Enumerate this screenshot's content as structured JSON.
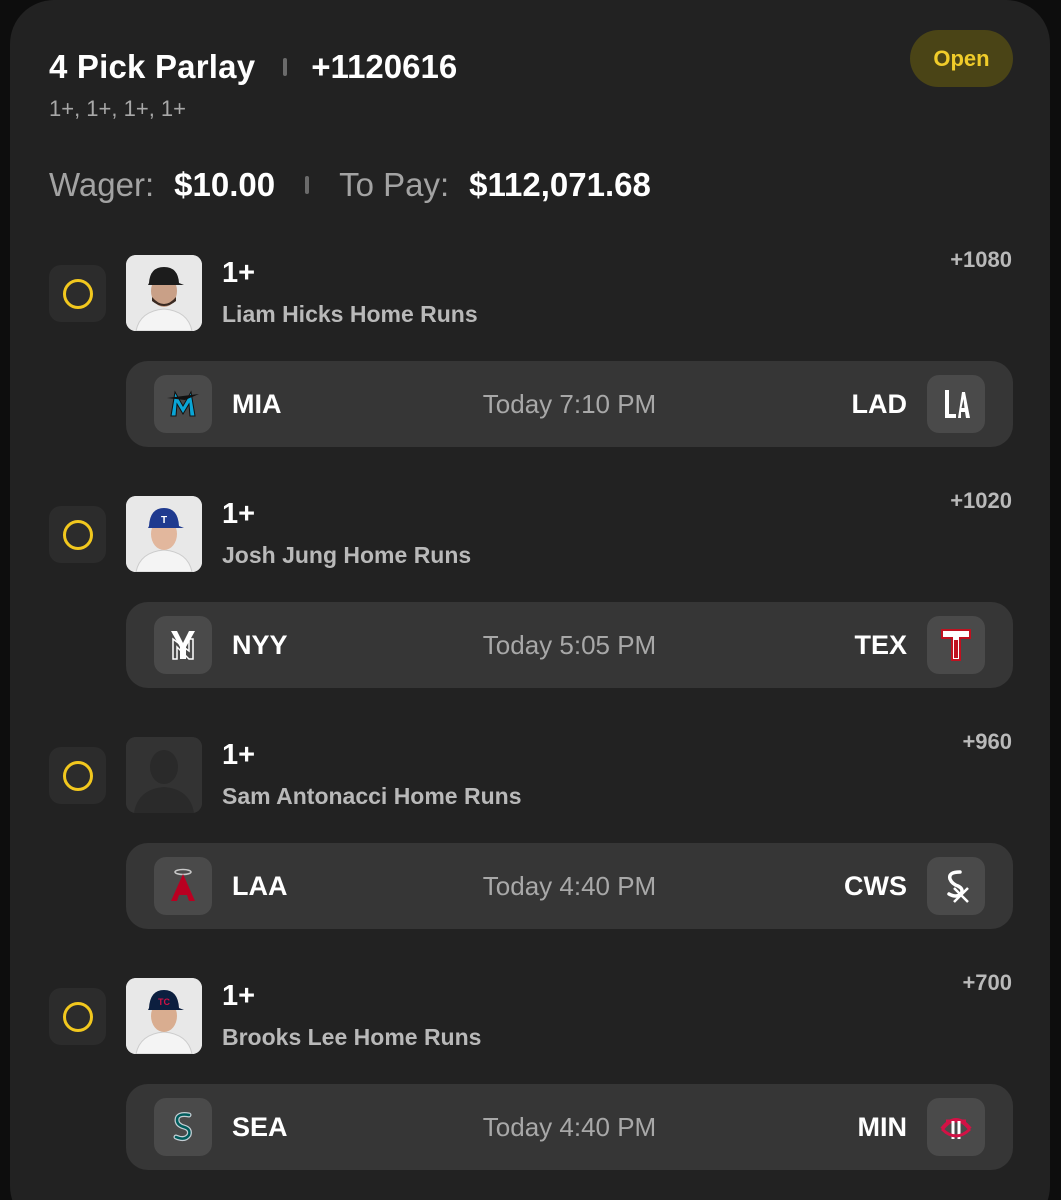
{
  "header": {
    "title": "4 Pick Parlay",
    "total_odds": "+1120616",
    "subtitle": "1+, 1+, 1+, 1+",
    "status": "Open"
  },
  "money": {
    "wager_label": "Wager:",
    "wager_value": "$10.00",
    "payout_label": "To Pay:",
    "payout_value": "$112,071.68"
  },
  "colors": {
    "accent_yellow": "#f2c81e",
    "card_bg": "#222222",
    "game_row_bg": "#363636"
  },
  "legs": [
    {
      "line": "1+",
      "market": "Liam Hicks Home Runs",
      "odds": "+1080",
      "player_image": "player-headshot",
      "away": {
        "abbr": "MIA",
        "icon": "marlins-logo-icon"
      },
      "time": "Today 7:10 PM",
      "home": {
        "abbr": "LAD",
        "icon": "dodgers-logo-icon"
      }
    },
    {
      "line": "1+",
      "market": "Josh Jung Home Runs",
      "odds": "+1020",
      "player_image": "player-headshot",
      "away": {
        "abbr": "NYY",
        "icon": "yankees-logo-icon"
      },
      "time": "Today 5:05 PM",
      "home": {
        "abbr": "TEX",
        "icon": "rangers-logo-icon"
      }
    },
    {
      "line": "1+",
      "market": "Sam Antonacci Home Runs",
      "odds": "+960",
      "player_image": "player-placeholder",
      "away": {
        "abbr": "LAA",
        "icon": "angels-logo-icon"
      },
      "time": "Today 4:40 PM",
      "home": {
        "abbr": "CWS",
        "icon": "white-sox-logo-icon"
      }
    },
    {
      "line": "1+",
      "market": "Brooks Lee Home Runs",
      "odds": "+700",
      "player_image": "player-headshot",
      "away": {
        "abbr": "SEA",
        "icon": "mariners-logo-icon"
      },
      "time": "Today 4:40 PM",
      "home": {
        "abbr": "MIN",
        "icon": "twins-logo-icon"
      }
    }
  ]
}
